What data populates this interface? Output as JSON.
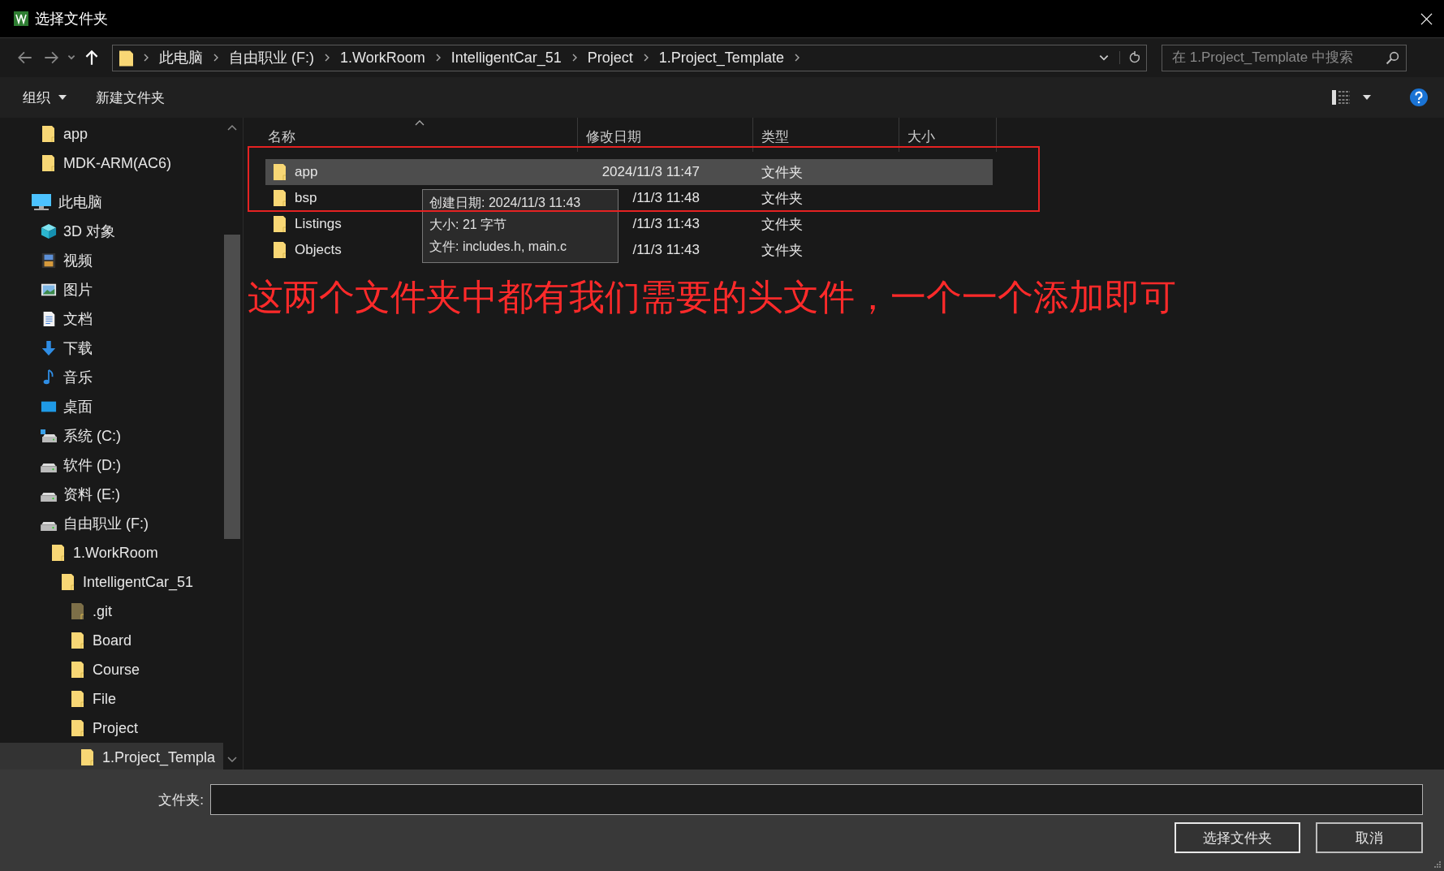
{
  "window": {
    "title": "选择文件夹"
  },
  "address": {
    "path": [
      "此电脑",
      "自由职业 (F:)",
      "1.WorkRoom",
      "IntelligentCar_51",
      "Project",
      "1.Project_Template"
    ],
    "search_placeholder": "在 1.Project_Template 中搜索"
  },
  "toolbar": {
    "organize": "组织",
    "new_folder": "新建文件夹"
  },
  "sidebar": {
    "upper_items": [
      {
        "label": "app",
        "kind": "folder",
        "selected": false
      },
      {
        "label": "MDK-ARM(AC6)",
        "kind": "folder",
        "selected": false
      }
    ],
    "items": [
      {
        "label": "此电脑",
        "kind": "pc",
        "selected": false,
        "children": [
          {
            "label": "3D 对象",
            "kind": "cube",
            "selected": false
          },
          {
            "label": "视频",
            "kind": "video",
            "selected": false
          },
          {
            "label": "图片",
            "kind": "image",
            "selected": false
          },
          {
            "label": "文档",
            "kind": "doc",
            "selected": false
          },
          {
            "label": "下载",
            "kind": "download",
            "selected": false
          },
          {
            "label": "音乐",
            "kind": "music",
            "selected": false
          },
          {
            "label": "桌面",
            "kind": "desktop",
            "selected": false
          },
          {
            "label": "系统 (C:)",
            "kind": "sysdrive",
            "selected": false
          },
          {
            "label": "软件 (D:)",
            "kind": "drive",
            "selected": false
          },
          {
            "label": "资料 (E:)",
            "kind": "drive",
            "selected": false
          },
          {
            "label": "自由职业 (F:)",
            "kind": "drive",
            "selected": false,
            "children": [
              {
                "label": "1.WorkRoom",
                "kind": "folder",
                "selected": false,
                "children": [
                  {
                    "label": "IntelligentCar_51",
                    "kind": "folder",
                    "selected": false,
                    "children": [
                      {
                        "label": ".git",
                        "kind": "hidden",
                        "selected": false
                      },
                      {
                        "label": "Board",
                        "kind": "folder",
                        "selected": false
                      },
                      {
                        "label": "Course",
                        "kind": "folder",
                        "selected": false
                      },
                      {
                        "label": "File",
                        "kind": "folder",
                        "selected": false
                      },
                      {
                        "label": "Project",
                        "kind": "folder",
                        "selected": false,
                        "children": [
                          {
                            "label": "1.Project_Templa",
                            "kind": "folder",
                            "selected": true
                          }
                        ]
                      }
                    ]
                  }
                ]
              }
            ]
          }
        ]
      }
    ]
  },
  "file_list": {
    "columns": [
      "名称",
      "修改日期",
      "类型",
      "大小"
    ],
    "rows": [
      {
        "name": "app",
        "modified": "2024/11/3 11:47",
        "type": "文件夹",
        "selected": true
      },
      {
        "name": "bsp",
        "modified": "/11/3 11:48",
        "type": "文件夹",
        "selected": false
      },
      {
        "name": "Listings",
        "modified": "/11/3 11:43",
        "type": "文件夹",
        "selected": false
      },
      {
        "name": "Objects",
        "modified": "/11/3 11:43",
        "type": "文件夹",
        "selected": false
      }
    ]
  },
  "tooltip": {
    "lines": [
      "创建日期: 2024/11/3 11:43",
      "大小: 21 字节",
      "文件: includes.h, main.c"
    ]
  },
  "annotation": {
    "text": "这两个文件夹中都有我们需要的头文件，一个一个添加即可"
  },
  "footer": {
    "folder_label": "文件夹:",
    "buttons": [
      "选择文件夹",
      "取消"
    ]
  }
}
